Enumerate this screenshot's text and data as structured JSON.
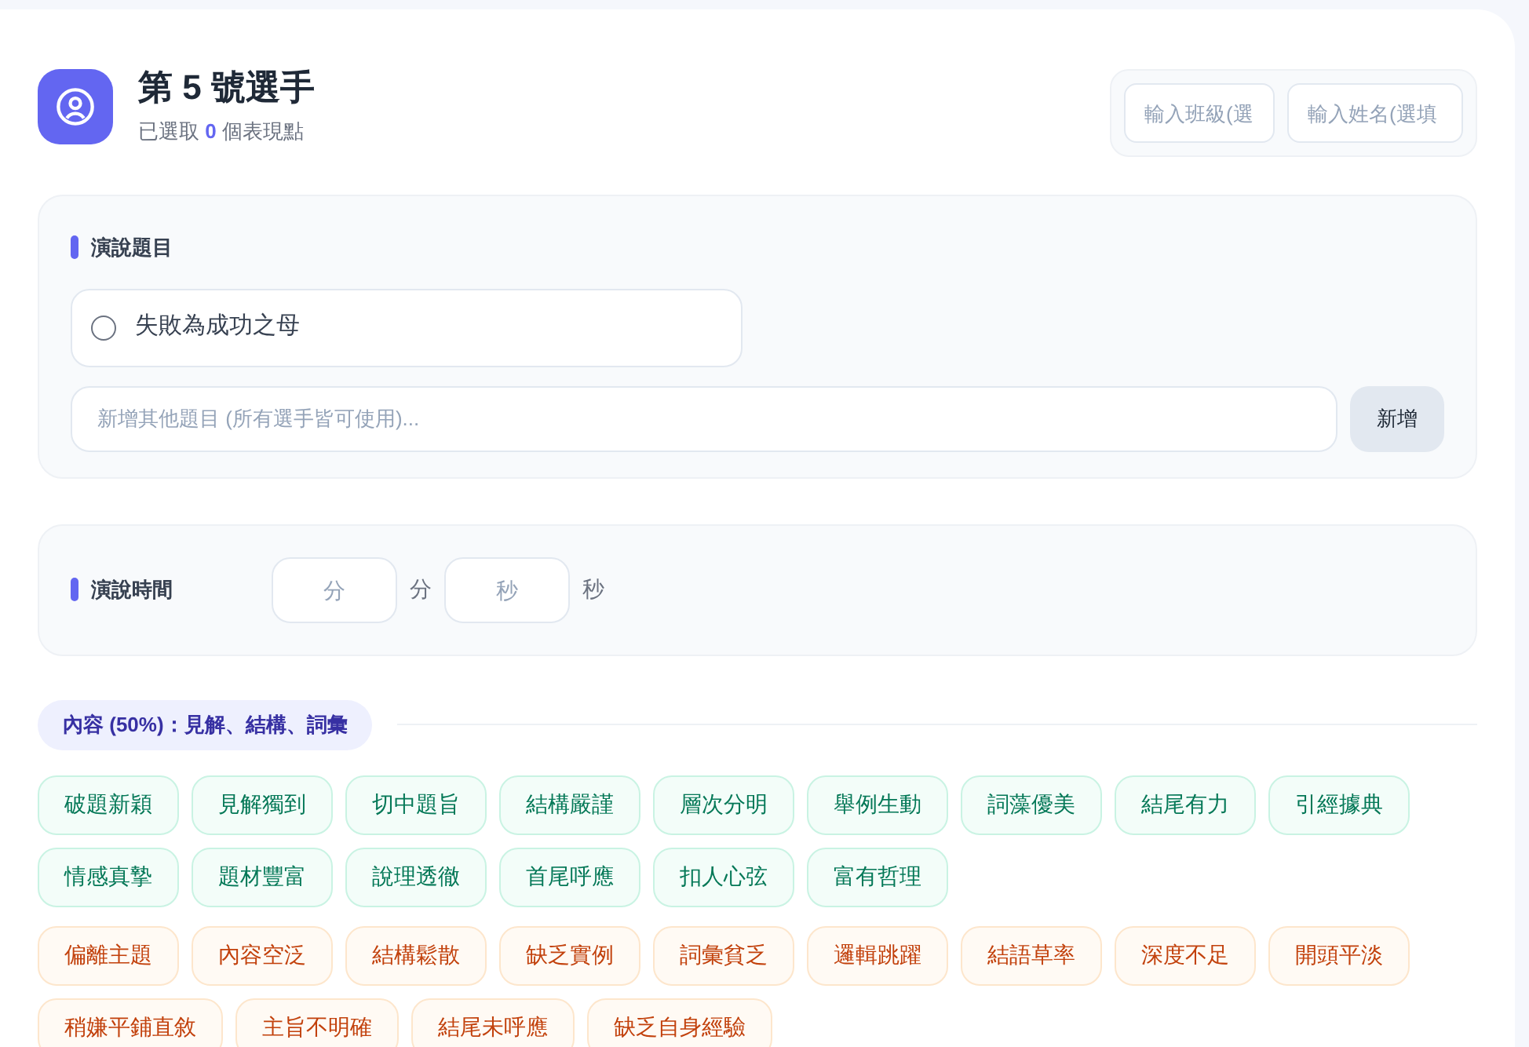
{
  "header": {
    "title": "第 5 號選手",
    "subtitle_prefix": "已選取",
    "selected_count": "0",
    "subtitle_suffix": "個表現點",
    "class_field": {
      "placeholder": "輸入班級(選"
    },
    "name_field": {
      "placeholder": "輸入姓名(選填"
    }
  },
  "topic_section": {
    "title": "演說題目",
    "topics": [
      {
        "label": "失敗為成功之母",
        "selected": false
      }
    ],
    "new_topic_field": {
      "placeholder": "新增其他題目 (所有選手皆可使用)..."
    },
    "add_button": "新增"
  },
  "time_section": {
    "title": "演說時間",
    "minutes_field": {
      "placeholder": "分"
    },
    "minutes_unit": "分",
    "seconds_field": {
      "placeholder": "秒"
    },
    "seconds_unit": "秒"
  },
  "content_section": {
    "title": "內容 (50%)：見解、結構、詞彙",
    "tags": [
      {
        "label": "破題新穎",
        "kind": "positive",
        "selected": false
      },
      {
        "label": "見解獨到",
        "kind": "positive",
        "selected": false
      },
      {
        "label": "切中題旨",
        "kind": "positive",
        "selected": false
      },
      {
        "label": "結構嚴謹",
        "kind": "positive",
        "selected": false
      },
      {
        "label": "層次分明",
        "kind": "positive",
        "selected": false
      },
      {
        "label": "舉例生動",
        "kind": "positive",
        "selected": false
      },
      {
        "label": "詞藻優美",
        "kind": "positive",
        "selected": false
      },
      {
        "label": "結尾有力",
        "kind": "positive",
        "selected": false
      },
      {
        "label": "引經據典",
        "kind": "positive",
        "selected": false
      },
      {
        "label": "情感真摯",
        "kind": "positive",
        "selected": false
      },
      {
        "label": "題材豐富",
        "kind": "positive",
        "selected": false
      },
      {
        "label": "說理透徹",
        "kind": "positive",
        "selected": false
      },
      {
        "label": "首尾呼應",
        "kind": "positive",
        "selected": false
      },
      {
        "label": "扣人心弦",
        "kind": "positive",
        "selected": false
      },
      {
        "label": "富有哲理",
        "kind": "positive",
        "selected": false
      },
      {
        "label": "偏離主題",
        "kind": "negative",
        "selected": false
      },
      {
        "label": "內容空泛",
        "kind": "negative",
        "selected": false
      },
      {
        "label": "結構鬆散",
        "kind": "negative",
        "selected": false
      },
      {
        "label": "缺乏實例",
        "kind": "negative",
        "selected": false
      },
      {
        "label": "詞彙貧乏",
        "kind": "negative",
        "selected": false
      },
      {
        "label": "邏輯跳躍",
        "kind": "negative",
        "selected": false
      },
      {
        "label": "結語草率",
        "kind": "negative",
        "selected": false
      },
      {
        "label": "深度不足",
        "kind": "negative",
        "selected": false
      },
      {
        "label": "開頭平淡",
        "kind": "negative",
        "selected": false
      },
      {
        "label": "稍嫌平鋪直敘",
        "kind": "negative",
        "selected": false
      },
      {
        "label": "主旨不明確",
        "kind": "negative",
        "selected": false
      },
      {
        "label": "結尾未呼應",
        "kind": "negative",
        "selected": false
      },
      {
        "label": "缺乏自身經驗",
        "kind": "negative",
        "selected": false
      }
    ]
  }
}
